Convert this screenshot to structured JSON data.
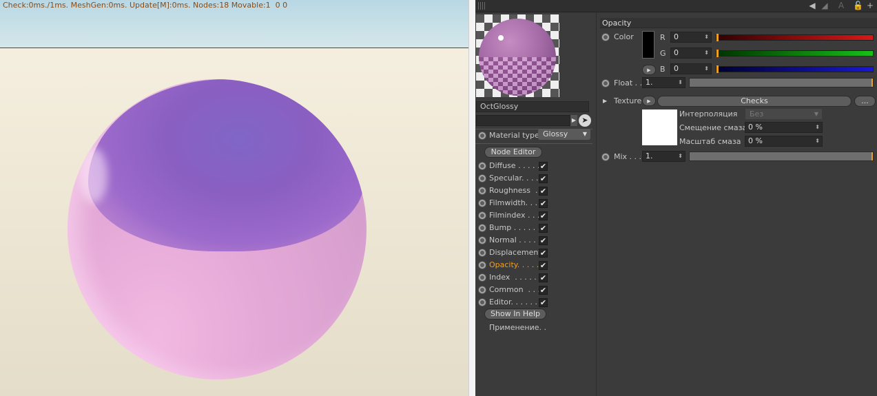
{
  "viewport": {
    "hud": "Check:0ms./1ms. MeshGen:0ms. Update[M]:0ms. Nodes:18 Movable:1  0 0"
  },
  "toolbar": {
    "icons": [
      "grip-icon",
      "back-arrow-icon",
      "forward-arrow-icon",
      "lock-icon",
      "add-icon"
    ]
  },
  "material": {
    "name": "OctGlossy",
    "type_label": "Material type",
    "type_value": "Glossy",
    "node_editor": "Node Editor",
    "channels": [
      {
        "label": "Diffuse . . . . .",
        "checked": "✔"
      },
      {
        "label": "Specular. . . .",
        "checked": "✔"
      },
      {
        "label": "Roughness  .",
        "checked": "✔"
      },
      {
        "label": "Filmwidth. . .",
        "checked": "✔"
      },
      {
        "label": "Filmindex . . .",
        "checked": "✔"
      },
      {
        "label": "Bump . . . . . .",
        "checked": "✔"
      },
      {
        "label": "Normal . . . . .",
        "checked": "✔"
      },
      {
        "label": "Displacement",
        "checked": "✔"
      },
      {
        "label": "Opacity. . . . .",
        "checked": "✔"
      },
      {
        "label": "Index  . . . . .",
        "checked": "✔"
      },
      {
        "label": "Common  . . .",
        "checked": "✔"
      },
      {
        "label": "Editor. . . . . .",
        "checked": "✔"
      }
    ],
    "active_channel": "Opacity",
    "show_in_help": "Show In Help",
    "apply_label": "Применение. ."
  },
  "opacity": {
    "header": "Opacity",
    "color_label": "Color",
    "r_label": "R",
    "r_value": "0",
    "g_label": "G",
    "g_value": "0",
    "b_label": "B",
    "b_value": "0",
    "float_label": "Float . .",
    "float_value": "1.",
    "texture_label": "Texture",
    "texture_name": "Checks",
    "more_button": "...",
    "interp_label": "Интерполяция",
    "interp_value": "Без",
    "blur_offset_label": "Смещение смаза",
    "blur_offset_value": "0 %",
    "blur_scale_label": "Масштаб смаза",
    "blur_scale_value": "0 %",
    "mix_label": "Mix . . .",
    "mix_value": "1."
  },
  "colors": {
    "accent": "#f0a020",
    "red_slider": "#d81818",
    "green_slider": "#18c018",
    "blue_slider": "#1818d0"
  }
}
